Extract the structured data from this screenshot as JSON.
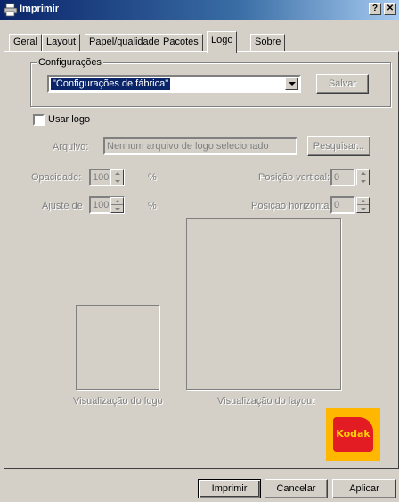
{
  "window": {
    "title": "Imprimir",
    "help_label": "?",
    "close_label": "✕"
  },
  "tabs": [
    {
      "label": "Geral"
    },
    {
      "label": "Layout"
    },
    {
      "label": "Papel/qualidade"
    },
    {
      "label": "Pacotes"
    },
    {
      "label": "Logo"
    },
    {
      "label": "Sobre"
    }
  ],
  "active_tab": "Logo",
  "config": {
    "group_label": "Configurações",
    "selected": "\"Configurações de fábrica\"",
    "save_label": "Salvar"
  },
  "logo": {
    "use_logo_label": "Usar logo",
    "use_logo_checked": false,
    "file_label": "Arquivo:",
    "file_value": "Nenhum arquivo de logo selecionado",
    "browse_label": "Pesquisar...",
    "opacity_label": "Opacidade:",
    "opacity_value": "100",
    "opacity_unit": "%",
    "scale_label": "Ajuste de",
    "scale_value": "100",
    "scale_unit": "%",
    "vpos_label": "Posição vertical:",
    "vpos_value": "0",
    "hpos_label": "Posição horizontal:",
    "hpos_value": "0",
    "logo_preview_label": "Visualização do logo",
    "layout_preview_label": "Visualização do layout"
  },
  "brand": {
    "text": "Kodak",
    "colors": {
      "yellow": "#ffb700",
      "red": "#e31b23"
    }
  },
  "footer": {
    "print_label": "Imprimir",
    "cancel_label": "Cancelar",
    "apply_label": "Aplicar"
  }
}
